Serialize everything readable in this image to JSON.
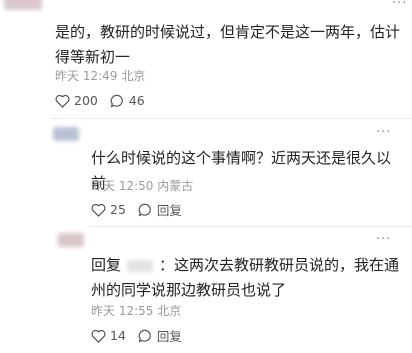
{
  "comments": [
    {
      "text": "是的，教研的时候说过，但肯定不是这一两年，估计得等新初一",
      "time": "昨天 12:49",
      "location": "北京",
      "likes": "200",
      "replies": "46"
    },
    {
      "text": "什么时候说的这个事情啊？近两天还是很久以前",
      "time": "昨天 12:50",
      "location": "内蒙古",
      "likes": "25",
      "reply_label": "回复"
    },
    {
      "reply_prefix": "回复",
      "text": "：这两次去教研教研员说的，我在通州的同学说那边教研员也说了",
      "time": "昨天 12:55",
      "location": "北京",
      "likes": "14",
      "reply_label": "回复"
    }
  ],
  "more_glyph": "···"
}
